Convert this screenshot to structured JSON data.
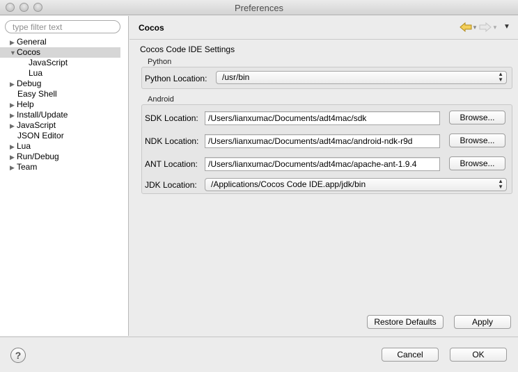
{
  "window": {
    "title": "Preferences"
  },
  "filter": {
    "placeholder": "type filter text"
  },
  "tree": {
    "items": [
      {
        "label": "General"
      },
      {
        "label": "Cocos"
      },
      {
        "label": "JavaScript"
      },
      {
        "label": "Lua"
      },
      {
        "label": "Debug"
      },
      {
        "label": "Easy Shell"
      },
      {
        "label": "Help"
      },
      {
        "label": "Install/Update"
      },
      {
        "label": "JavaScript"
      },
      {
        "label": "JSON Editor"
      },
      {
        "label": "Lua"
      },
      {
        "label": "Run/Debug"
      },
      {
        "label": "Team"
      }
    ]
  },
  "page": {
    "title": "Cocos",
    "settings_title": "Cocos Code IDE Settings",
    "python": {
      "group_label": "Python",
      "location_label": "Python Location:",
      "location_value": "/usr/bin"
    },
    "android": {
      "group_label": "Android",
      "sdk_label": "SDK Location:",
      "sdk_value": "/Users/lianxumac/Documents/adt4mac/sdk",
      "ndk_label": "NDK Location:",
      "ndk_value": "/Users/lianxumac/Documents/adt4mac/android-ndk-r9d",
      "ant_label": "ANT Location:",
      "ant_value": "/Users/lianxumac/Documents/adt4mac/apache-ant-1.9.4",
      "jdk_label": "JDK Location:",
      "jdk_value": "/Applications/Cocos Code IDE.app/jdk/bin",
      "browse_label": "Browse..."
    },
    "restore_defaults_label": "Restore Defaults",
    "apply_label": "Apply"
  },
  "footer": {
    "help_symbol": "?",
    "cancel_label": "Cancel",
    "ok_label": "OK"
  },
  "icons": {
    "back": "arrow-left-icon",
    "forward": "arrow-right-icon",
    "menu": "chevron-down-icon",
    "help": "help-icon"
  },
  "colors": {
    "selection": "#d6d6d6",
    "back_arrow": "#f0c14b"
  }
}
